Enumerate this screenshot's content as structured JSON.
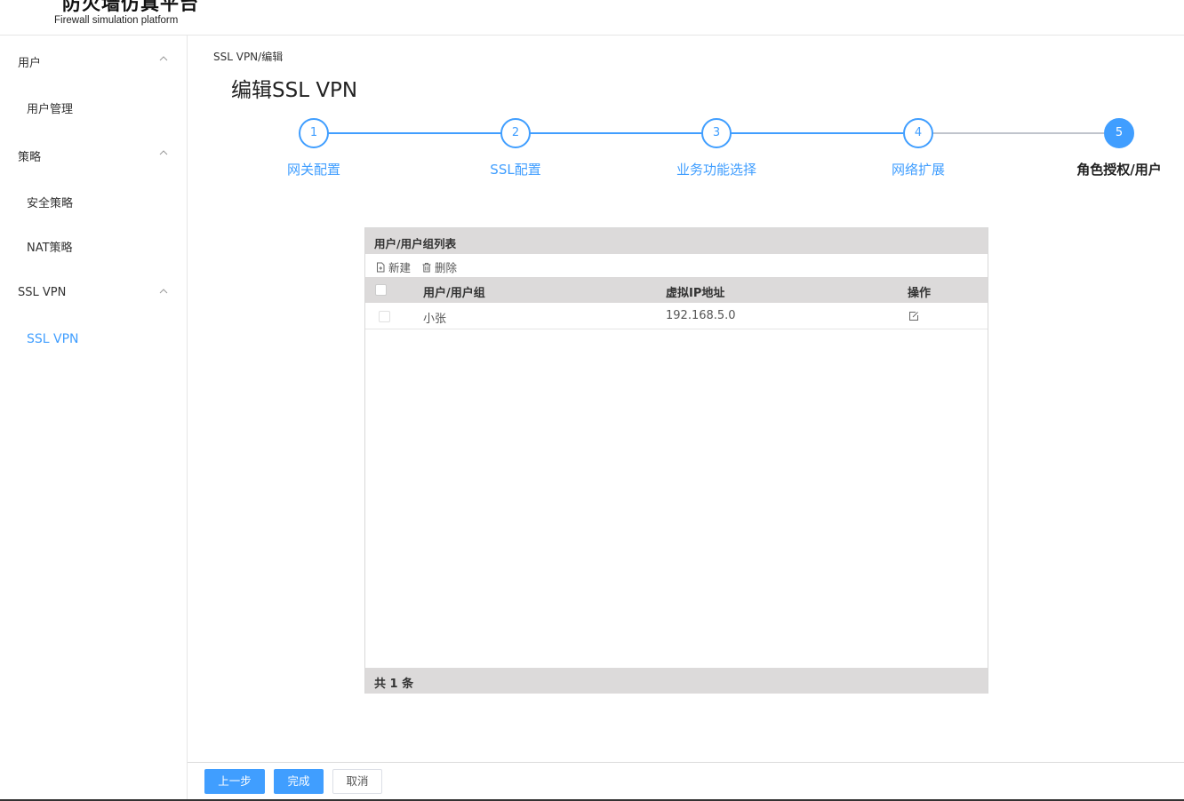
{
  "header": {
    "logo_title": "防火墙仿真平台",
    "logo_subtitle": "Firewall simulation platform"
  },
  "sidebar": {
    "groups": [
      {
        "label": "用户",
        "expanded": true,
        "items": [
          {
            "label": "用户管理",
            "active": false
          }
        ]
      },
      {
        "label": "策略",
        "expanded": true,
        "items": [
          {
            "label": "安全策略",
            "active": false
          },
          {
            "label": "NAT策略",
            "active": false
          }
        ]
      },
      {
        "label": "SSL VPN",
        "expanded": true,
        "items": [
          {
            "label": "SSL VPN",
            "active": true
          }
        ]
      }
    ]
  },
  "breadcrumb": "SSL VPN/编辑",
  "page_title": "编辑SSL VPN",
  "steps": [
    {
      "number": "1",
      "label": "网关配置",
      "status": "done"
    },
    {
      "number": "2",
      "label": "SSL配置",
      "status": "done"
    },
    {
      "number": "3",
      "label": "业务功能选择",
      "status": "done"
    },
    {
      "number": "4",
      "label": "网络扩展",
      "status": "done"
    },
    {
      "number": "5",
      "label": "角色授权/用户",
      "status": "current"
    }
  ],
  "panel": {
    "title": "用户/用户组列表",
    "toolbar": {
      "new_label": "新建",
      "delete_label": "删除"
    },
    "columns": [
      "用户/用户组",
      "虚拟IP地址",
      "操作"
    ],
    "rows": [
      {
        "name": "小张",
        "virtual_ip": "192.168.5.0",
        "action_icon": "edit-icon"
      }
    ],
    "footer": "共 1 条"
  },
  "buttons": {
    "prev": "上一步",
    "finish": "完成",
    "cancel": "取消"
  },
  "colors": {
    "accent": "#409eff",
    "header_gray": "#dcdada",
    "pending_line": "#c0c4cc"
  }
}
